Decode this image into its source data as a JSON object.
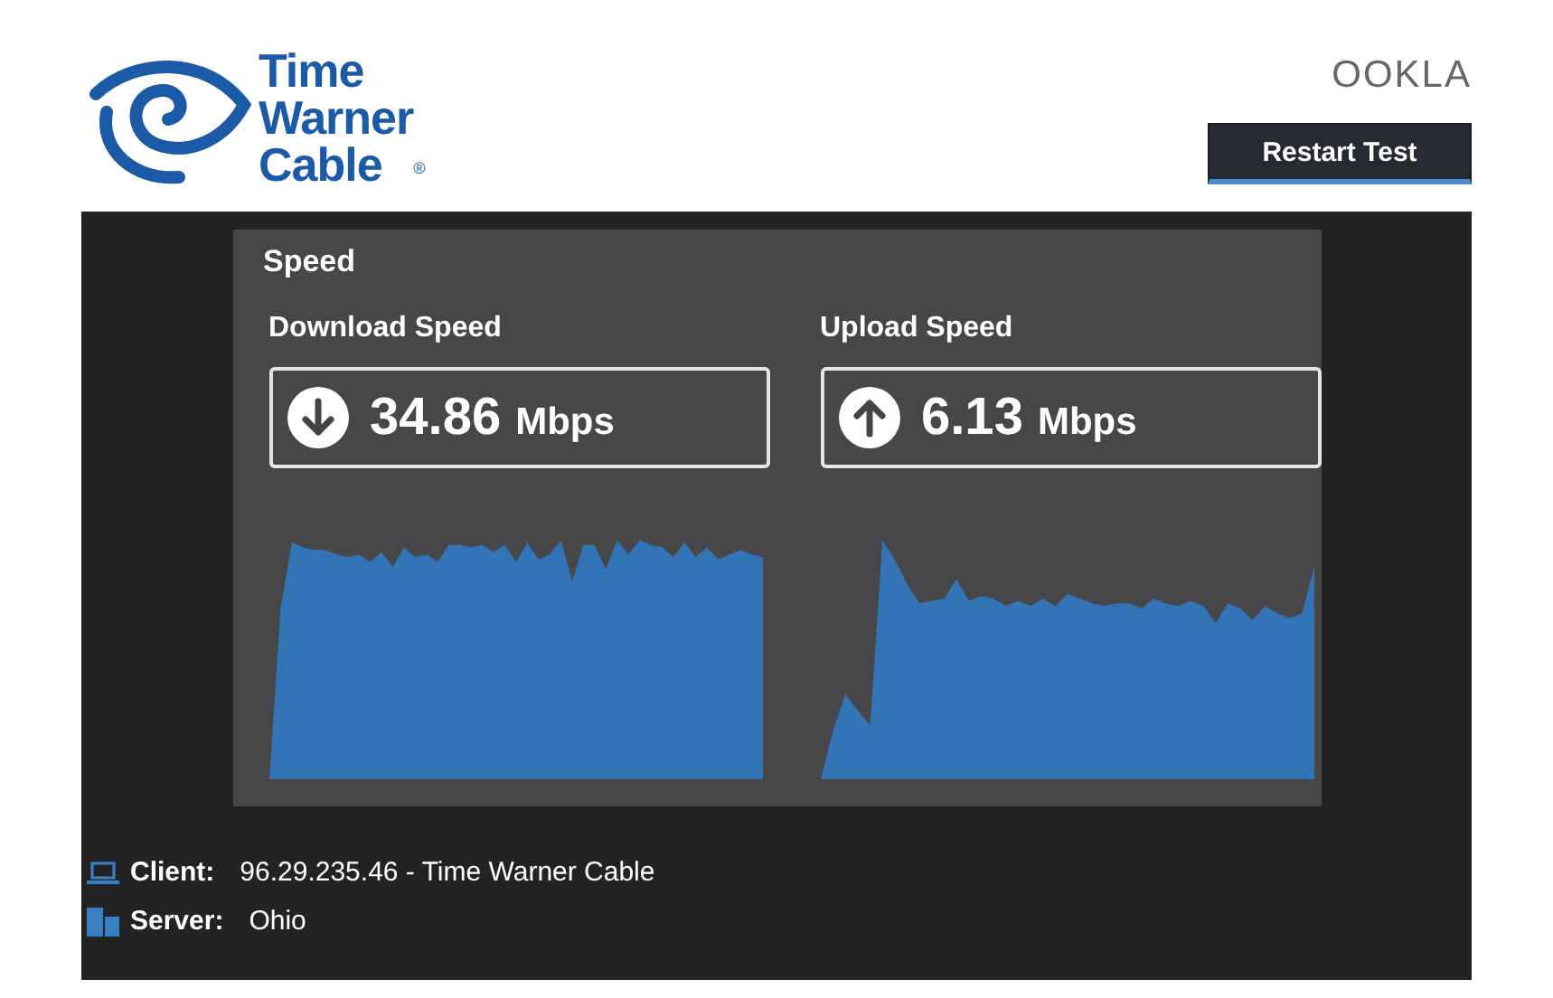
{
  "header": {
    "logo_lines": [
      "Time",
      "Warner",
      "Cable"
    ],
    "logo_mark": "®",
    "brand": "OOKLA",
    "restart_button": "Restart Test"
  },
  "speed": {
    "title": "Speed",
    "tests": [
      {
        "kind": "down",
        "label": "Download Speed",
        "value": "34.86",
        "unit": "Mbps"
      },
      {
        "kind": "up",
        "label": "Upload Speed",
        "value": "6.13",
        "unit": "Mbps"
      }
    ]
  },
  "info": [
    {
      "kind": "client",
      "label": "Client:",
      "value": "96.29.235.46 - Time Warner Cable"
    },
    {
      "kind": "server",
      "label": "Server:",
      "value": "Ohio"
    }
  ]
}
